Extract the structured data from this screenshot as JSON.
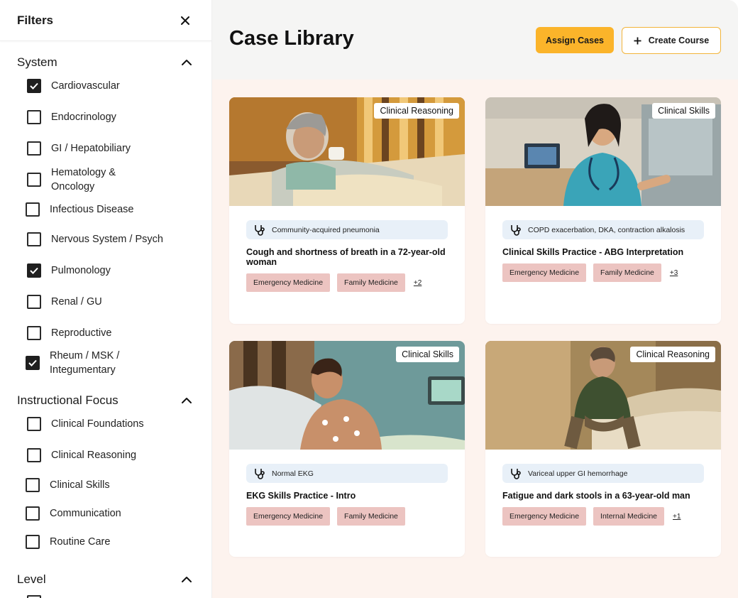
{
  "sidebar": {
    "title": "Filters",
    "sections": [
      {
        "title": "System",
        "options": [
          {
            "label": "Cardiovascular",
            "checked": true
          },
          {
            "label": "Endocrinology",
            "checked": false
          },
          {
            "label": "GI / Hepatobiliary",
            "checked": false
          },
          {
            "label": "Hematology & Oncology",
            "checked": false
          },
          {
            "label": "Infectious Disease",
            "checked": false
          },
          {
            "label": "Nervous System / Psych",
            "checked": false
          },
          {
            "label": "Pulmonology",
            "checked": true
          },
          {
            "label": "Renal / GU",
            "checked": false
          },
          {
            "label": "Reproductive",
            "checked": false
          },
          {
            "label": "Rheum / MSK / Integumentary",
            "checked": true
          }
        ]
      },
      {
        "title": "Instructional Focus",
        "options": [
          {
            "label": "Clinical Foundations",
            "checked": false
          },
          {
            "label": "Clinical Reasoning",
            "checked": false
          },
          {
            "label": "Clinical Skills",
            "checked": false
          },
          {
            "label": "Communication",
            "checked": false
          },
          {
            "label": "Routine Care",
            "checked": false
          }
        ]
      },
      {
        "title": "Level",
        "options": []
      }
    ]
  },
  "header": {
    "title": "Case Library",
    "assign_label": "Assign Cases",
    "create_label": "Create Course"
  },
  "cards": [
    {
      "category": "Clinical Reasoning",
      "diagnosis": "Community-acquired pneumonia",
      "title": "Cough and shortness of breath in a 72-year-old woman",
      "tags": [
        "Emergency Medicine",
        "Family Medicine"
      ],
      "more": "+2"
    },
    {
      "category": "Clinical Skills",
      "diagnosis": "COPD exacerbation, DKA, contraction alkalosis",
      "title": "Clinical Skills Practice - ABG Interpretation",
      "tags": [
        "Emergency Medicine",
        "Family Medicine"
      ],
      "more": "+3"
    },
    {
      "category": "Clinical Skills",
      "diagnosis": "Normal EKG",
      "title": "EKG Skills Practice - Intro",
      "tags": [
        "Emergency Medicine",
        "Family Medicine"
      ],
      "more": ""
    },
    {
      "category": "Clinical Reasoning",
      "diagnosis": "Variceal upper GI hemorrhage",
      "title": "Fatigue and dark stools in a 63-year-old man",
      "tags": [
        "Emergency Medicine",
        "Internal Medicine"
      ],
      "more": "+1"
    }
  ],
  "colors": {
    "accent": "#fbb42a",
    "tag_bg": "#ecc4c1",
    "diag_bg": "#e8f0f8"
  }
}
